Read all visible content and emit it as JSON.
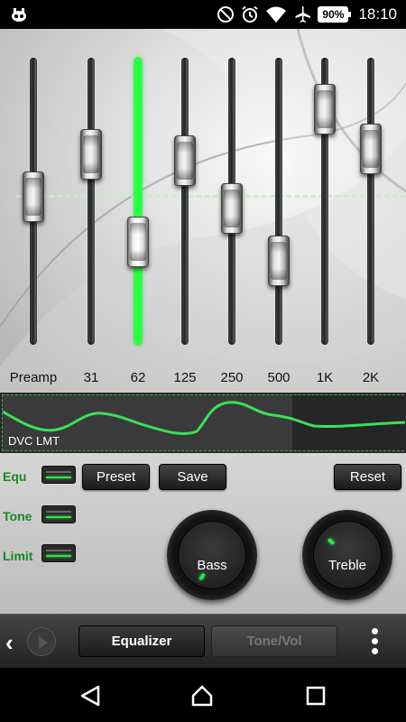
{
  "status_bar": {
    "battery": "90%",
    "time": "18:10",
    "icons": [
      "app-notification-icon",
      "do-not-disturb-icon",
      "alarm-icon",
      "wifi-icon",
      "airplane-icon",
      "battery-icon"
    ]
  },
  "equalizer": {
    "bands": [
      {
        "label": "Preamp",
        "level": 0.52,
        "active": false
      },
      {
        "label": "31",
        "level": 0.7,
        "active": false
      },
      {
        "label": "62",
        "level": 0.33,
        "active": true
      },
      {
        "label": "125",
        "level": 0.67,
        "active": false
      },
      {
        "label": "250",
        "level": 0.47,
        "active": false
      },
      {
        "label": "500",
        "level": 0.25,
        "active": false
      },
      {
        "label": "1K",
        "level": 0.89,
        "active": false
      },
      {
        "label": "2K",
        "level": 0.72,
        "active": false
      }
    ]
  },
  "curve": {
    "label": "DVC LMT"
  },
  "controls": {
    "equ_label": "Equ",
    "tone_label": "Tone",
    "limit_label": "Limit",
    "preset_label": "Preset",
    "save_label": "Save",
    "reset_label": "Reset",
    "bass_label": "Bass",
    "treble_label": "Treble"
  },
  "tabs": {
    "equalizer_label": "Equalizer",
    "tonevol_label": "Tone/Vol"
  },
  "colors": {
    "accent_green": "#2bff45",
    "label_green": "#168a22"
  }
}
